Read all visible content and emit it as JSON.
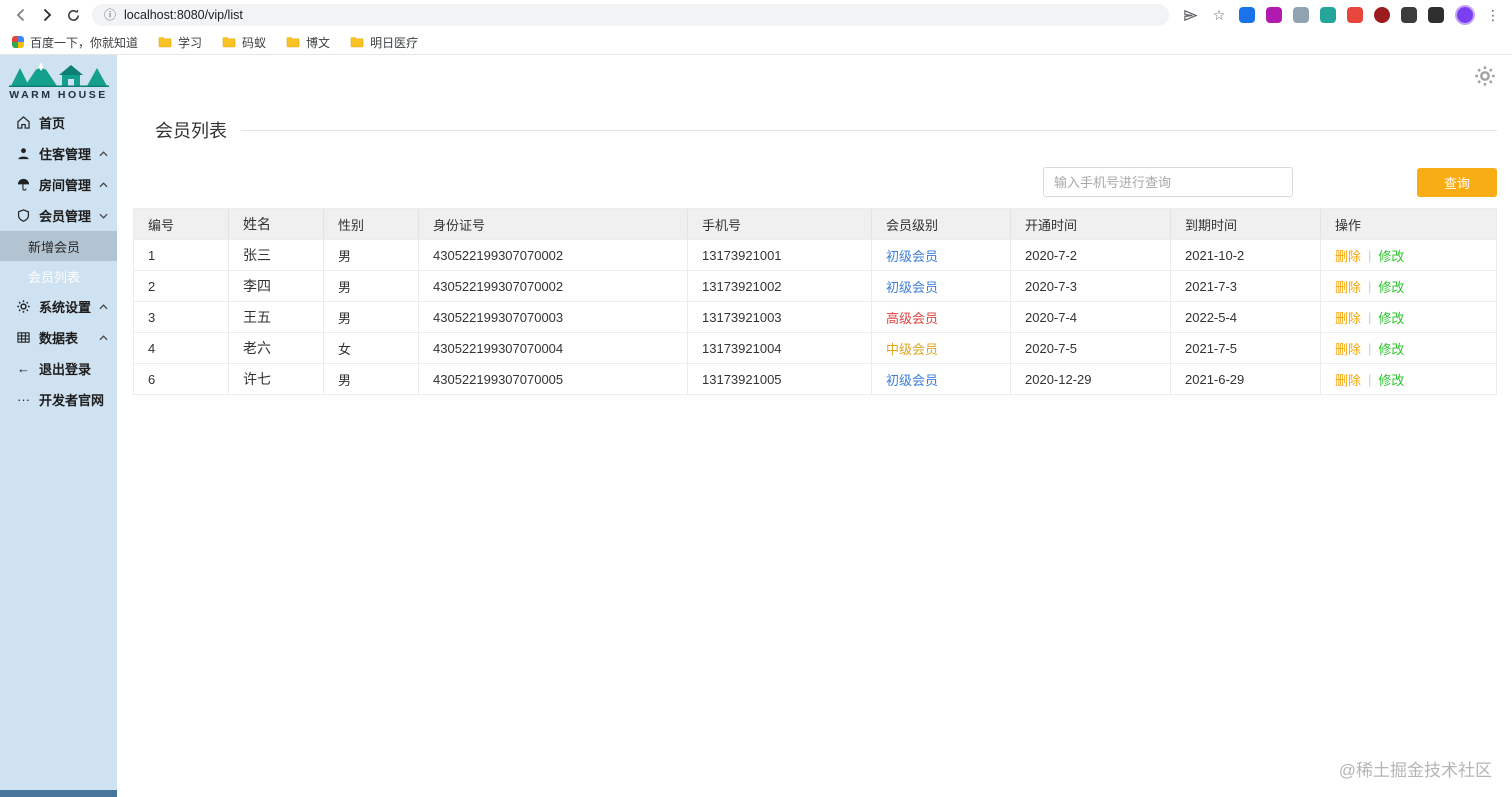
{
  "browser": {
    "url": "localhost:8080/vip/list",
    "bookmarks": [
      {
        "label": "百度一下，你就知道",
        "icon": "baidu-favicon"
      },
      {
        "label": "学习",
        "icon": "folder-icon"
      },
      {
        "label": "码蚁",
        "icon": "folder-icon"
      },
      {
        "label": "博文",
        "icon": "folder-icon"
      },
      {
        "label": "明日医疗",
        "icon": "folder-icon"
      }
    ]
  },
  "sidebar": {
    "logo_text": "WARM HOUSE",
    "items": {
      "home": "首页",
      "guest": "住客管理",
      "room": "房间管理",
      "vip": "会员管理",
      "vip_add": "新增会员",
      "vip_list": "会员列表",
      "settings": "系统设置",
      "tables": "数据表",
      "logout": "退出登录",
      "devsite": "开发者官网"
    },
    "icons": {
      "logout_glyph": "←",
      "devsite_glyph": "···"
    }
  },
  "main": {
    "title": "会员列表",
    "search": {
      "placeholder": "输入手机号进行查询",
      "button_label": "查询"
    },
    "table": {
      "headers": [
        "编号",
        "姓名",
        "性别",
        "身份证号",
        "手机号",
        "会员级别",
        "开通时间",
        "到期时间",
        "操作"
      ],
      "rows": [
        {
          "id": "1",
          "name": "张三",
          "gender": "男",
          "idcard": "430522199307070002",
          "phone": "13173921001",
          "level": "初级会员",
          "level_color": "#3d7fd9",
          "start": "2020-7-2",
          "end": "2021-10-2"
        },
        {
          "id": "2",
          "name": "李四",
          "gender": "男",
          "idcard": "430522199307070002",
          "phone": "13173921002",
          "level": "初级会员",
          "level_color": "#3d7fd9",
          "start": "2020-7-3",
          "end": "2021-7-3"
        },
        {
          "id": "3",
          "name": "王五",
          "gender": "男",
          "idcard": "430522199307070003",
          "phone": "13173921003",
          "level": "高级会员",
          "level_color": "#e04343",
          "start": "2020-7-4",
          "end": "2022-5-4"
        },
        {
          "id": "4",
          "name": "老六",
          "gender": "女",
          "idcard": "430522199307070004",
          "phone": "13173921004",
          "level": "中级会员",
          "level_color": "#dfa625",
          "start": "2020-7-5",
          "end": "2021-7-5"
        },
        {
          "id": "6",
          "name": "许七",
          "gender": "男",
          "idcard": "430522199307070005",
          "phone": "13173921005",
          "level": "初级会员",
          "level_color": "#3d7fd9",
          "start": "2020-12-29",
          "end": "2021-6-29"
        }
      ],
      "actions": {
        "delete": "删除",
        "separator": "|",
        "edit": "修改"
      }
    },
    "watermark": "@稀土掘金技术社区"
  },
  "colors": {
    "accent_button": "#f9ad14",
    "sidebar_bg": "#cfe2f1",
    "level_junior": "#3d7fd9",
    "level_middle": "#dfa625",
    "level_senior": "#e04343",
    "action_delete": "#f5a60a",
    "action_edit": "#2fc42f"
  }
}
